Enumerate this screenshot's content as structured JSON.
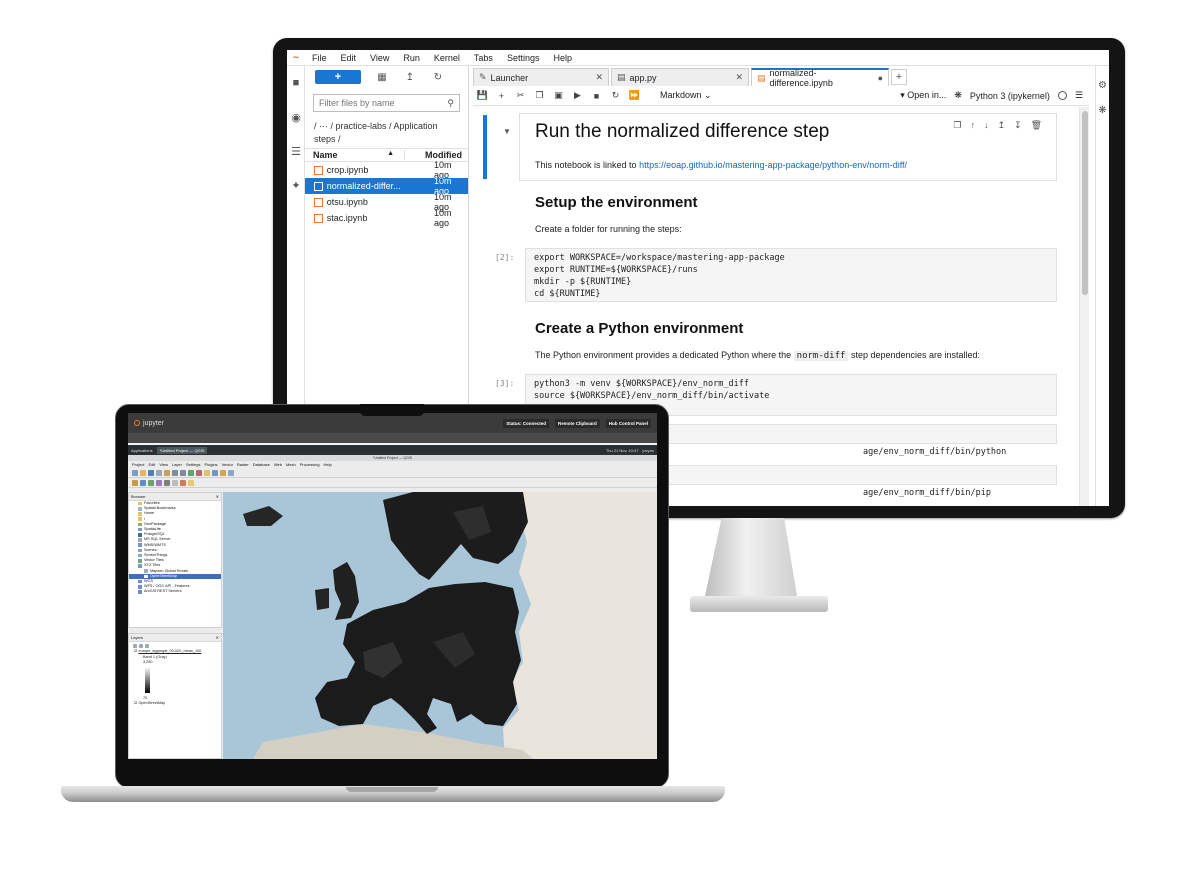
{
  "jupyter": {
    "menu": [
      "File",
      "Edit",
      "View",
      "Run",
      "Kernel",
      "Tabs",
      "Settings",
      "Help"
    ],
    "filebrowser": {
      "new_label": "+",
      "filter_placeholder": "Filter files by name",
      "breadcrumb": "/ ··· / practice-labs / Application steps /",
      "col_name": "Name",
      "col_modified": "Modified",
      "files": [
        {
          "name": "crop.ipynb",
          "modified": "10m ago"
        },
        {
          "name": "normalized-differ...",
          "modified": "10m ago"
        },
        {
          "name": "otsu.ipynb",
          "modified": "10m ago"
        },
        {
          "name": "stac.ipynb",
          "modified": "10m ago"
        }
      ]
    },
    "tabs": [
      "Launcher",
      "app.py",
      "normalized-difference.ipynb"
    ],
    "toolbar": {
      "cell_type": "Markdown",
      "open_in": "Open in...",
      "kernel": "Python 3 (ipykernel)"
    },
    "notebook": {
      "h1": "Run the normalized difference step",
      "p1_text": "This notebook is linked to ",
      "p1_link": "https://eoap.github.io/mastering-app-package/python-env/norm-diff/",
      "h2a": "Setup the environment",
      "p2": "Create a folder for running the steps:",
      "prompt2": "[2]:",
      "code2": "export WORKSPACE=/workspace/mastering-app-package\nexport RUNTIME=${WORKSPACE}/runs\nmkdir -p ${RUNTIME}\ncd ${RUNTIME}",
      "h2b": "Create a Python environment",
      "p3_before": "The Python environment provides a dedicated Python where the ",
      "p3_code": "norm-diff",
      "p3_after": " step dependencies are installed:",
      "prompt3": "[3]:",
      "code3": "python3 -m venv ${WORKSPACE}/env_norm_diff\nsource ${WORKSPACE}/env_norm_diff/bin/activate",
      "frag1": "age/env_norm_diff/bin/python",
      "frag2": "age/env_norm_diff/bin/pip"
    }
  },
  "laptop": {
    "hub_brand": "jupyter",
    "hub_buttons": [
      "Status: Connected",
      "Remote Clipboard",
      "Hub Control Panel"
    ],
    "panel_items": [
      "Applications",
      "*Untitled Project — QGIS"
    ],
    "panel_clock": "Thu 21 Nov, 10:47",
    "panel_user": "jovyan",
    "qgis_title": "*Untitled Project — QGIS",
    "qgis_menu": [
      "Project",
      "Edit",
      "View",
      "Layer",
      "Settings",
      "Plugins",
      "Vector",
      "Raster",
      "Database",
      "Web",
      "Mesh",
      "Processing",
      "Help"
    ],
    "browser_title": "Browser",
    "browser_items": [
      "Favorites",
      "Spatial Bookmarks",
      "Home",
      "/",
      "GeoPackage",
      "SpatiaLite",
      "PostgreSQL",
      "MS SQL Server",
      "WMS/WMTS",
      "Scenes",
      "SensorThings",
      "Vector Tiles",
      "XYZ Tiles",
      "Mapzen Global Terrain",
      "OpenStreetMap",
      "WCS",
      "WFS / OGC API - Features",
      "ArcGIS REST Servers"
    ],
    "layers_title": "Layers",
    "layer_raster": "europe_aggregat_00-020_mean_100",
    "layer_band": "Band 1 (Gray)",
    "legend_max": "3,250",
    "legend_min": "70",
    "layer_osm": "OpenStreetMap"
  },
  "colors": {
    "accent": "#1976d2",
    "jupyter_orange": "#f37726",
    "map_sea": "#a9c6d9",
    "map_land": "#e9e5dc",
    "raster": "#1c1c1c"
  }
}
